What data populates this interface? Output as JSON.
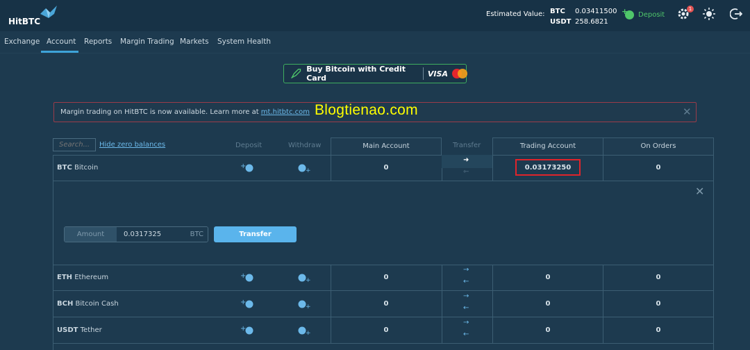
{
  "brand": {
    "logo_text": "HitBTC"
  },
  "header": {
    "estimated_label": "Estimated Value:",
    "balances": [
      {
        "cur": "BTC",
        "value": "0.03411500"
      },
      {
        "cur": "USDT",
        "value": "258.6821"
      }
    ],
    "deposit_label": "Deposit",
    "notifications_count": "1"
  },
  "nav": {
    "items": [
      "Exchange",
      "Account",
      "Reports",
      "Margin Trading",
      "Markets",
      "System Health"
    ],
    "active": "Account"
  },
  "promo": {
    "label": "Buy Bitcoin with Credit Card",
    "visa": "VISA"
  },
  "notice": {
    "text": "Margin trading on HitBTC is now available. Learn more at ",
    "link": "mt.hitbtc.com"
  },
  "watermark": "Blogtienao.com",
  "table": {
    "search_placeholder": "Search...",
    "hide_zero": "Hide zero balances",
    "headers": {
      "deposit": "Deposit",
      "withdraw": "Withdraw",
      "main": "Main Account",
      "transfer": "Transfer",
      "trading": "Trading Account",
      "orders": "On Orders"
    },
    "rows": [
      {
        "symbol": "BTC",
        "name": "Bitcoin",
        "main": "0",
        "trading": "0.03173250",
        "orders": "0"
      },
      {
        "symbol": "ETH",
        "name": "Ethereum",
        "main": "0",
        "trading": "0",
        "orders": "0"
      },
      {
        "symbol": "BCH",
        "name": "Bitcoin Cash",
        "main": "0",
        "trading": "0",
        "orders": "0"
      },
      {
        "symbol": "USDT",
        "name": "Tether",
        "main": "0",
        "trading": "0",
        "orders": "0"
      }
    ]
  },
  "transfer_panel": {
    "amount_label": "Amount",
    "amount_value": "0.0317325",
    "currency": "BTC",
    "button": "Transfer"
  },
  "colors": {
    "accent": "#3ea3d9",
    "deposit_green": "#4fc66a",
    "highlight_red": "#e0242b",
    "watermark_yellow": "#ffff00"
  }
}
